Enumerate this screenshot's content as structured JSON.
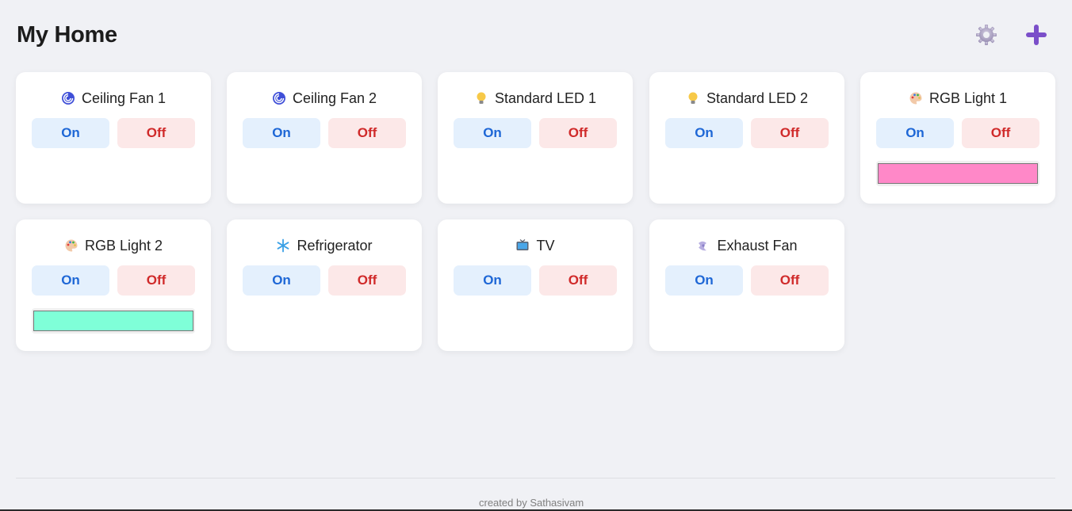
{
  "header": {
    "title": "My Home"
  },
  "devices": [
    {
      "name": "Ceiling Fan 1",
      "icon": "cyclone-icon",
      "on_label": "On",
      "off_label": "Off"
    },
    {
      "name": "Ceiling Fan 2",
      "icon": "cyclone-icon",
      "on_label": "On",
      "off_label": "Off"
    },
    {
      "name": "Standard LED 1",
      "icon": "light-bulb-icon",
      "on_label": "On",
      "off_label": "Off"
    },
    {
      "name": "Standard LED 2",
      "icon": "light-bulb-icon",
      "on_label": "On",
      "off_label": "Off"
    },
    {
      "name": "RGB Light 1",
      "icon": "palette-icon",
      "on_label": "On",
      "off_label": "Off",
      "color": "#ff88c8"
    },
    {
      "name": "RGB Light 2",
      "icon": "palette-icon",
      "on_label": "On",
      "off_label": "Off",
      "color": "#7fffd8"
    },
    {
      "name": "Refrigerator",
      "icon": "snowflake-icon",
      "on_label": "On",
      "off_label": "Off"
    },
    {
      "name": "TV",
      "icon": "television-icon",
      "on_label": "On",
      "off_label": "Off"
    },
    {
      "name": "Exhaust Fan",
      "icon": "wind-icon",
      "on_label": "On",
      "off_label": "Off"
    }
  ],
  "footer": {
    "credit": "created by Sathasivam"
  },
  "colors": {
    "background": "#f0f1f5",
    "on_bg": "#e4f0fd",
    "on_text": "#1e67d6",
    "off_bg": "#fce8e8",
    "off_text": "#d02a2a",
    "add_icon": "#7b4fc9"
  }
}
